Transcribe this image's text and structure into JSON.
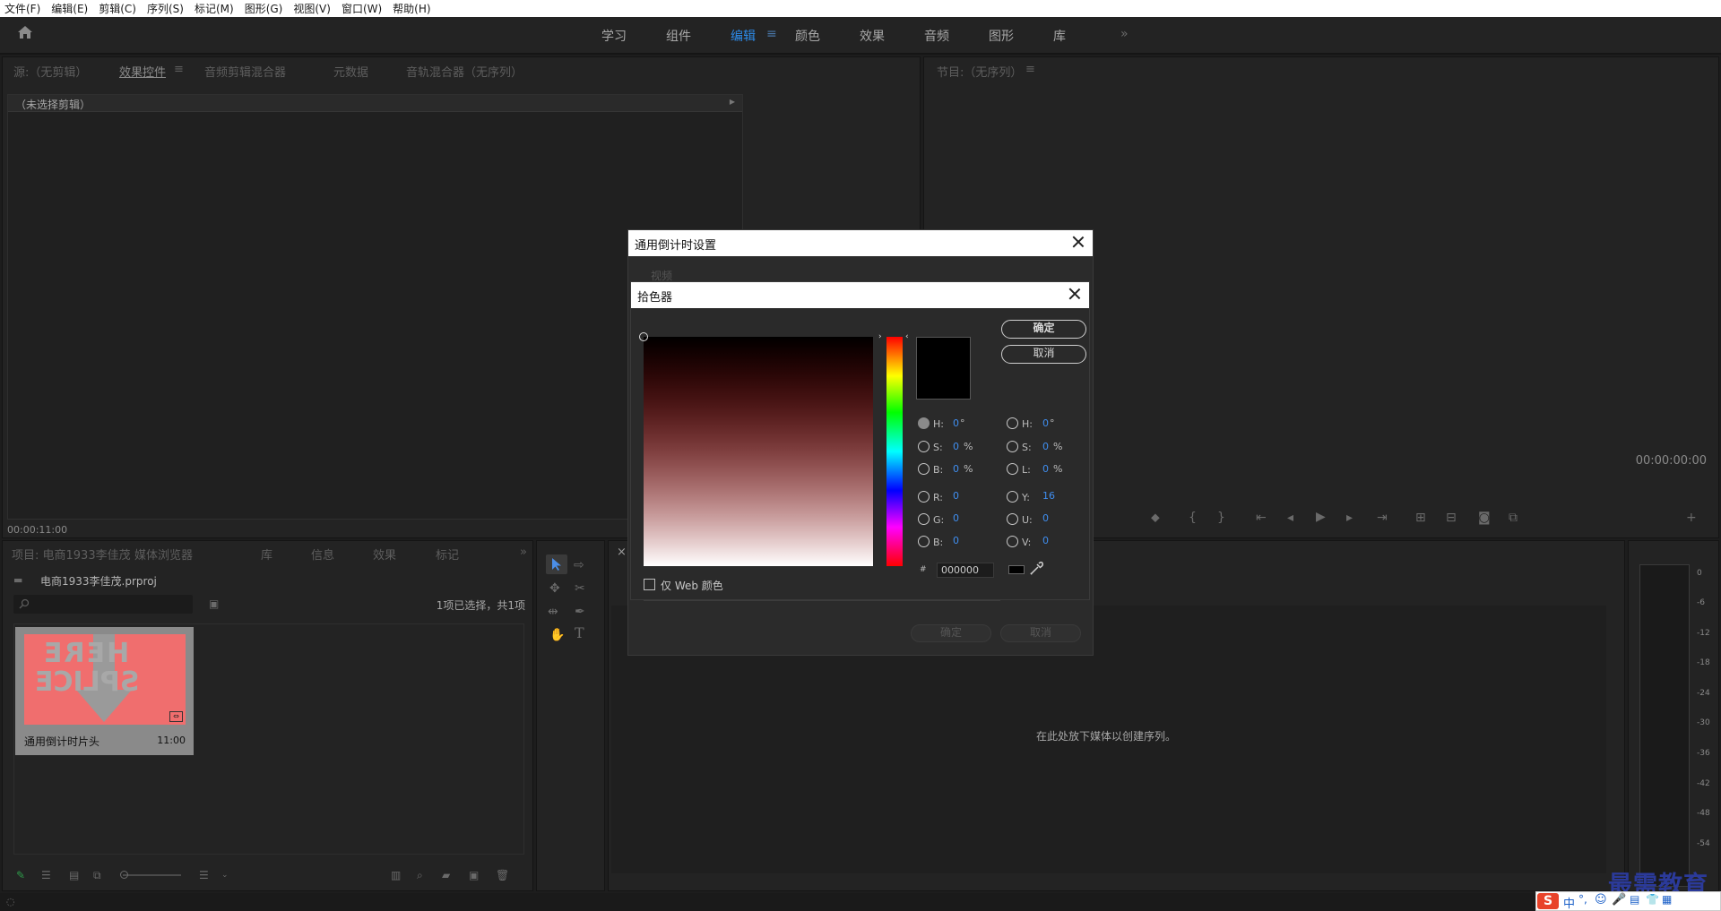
{
  "menu": [
    "文件(F)",
    "编辑(E)",
    "剪辑(C)",
    "序列(S)",
    "标记(M)",
    "图形(G)",
    "视图(V)",
    "窗口(W)",
    "帮助(H)"
  ],
  "workspaces": [
    "学习",
    "组件",
    "编辑",
    "颜色",
    "效果",
    "音频",
    "图形",
    "库"
  ],
  "active_workspace": "编辑",
  "source_panel": {
    "tabs": [
      "源:（无剪辑）",
      "效果控件",
      "音频剪辑混合器",
      "元数据",
      "音轨混合器（无序列）"
    ],
    "header": "（未选择剪辑）",
    "timecode": "00:00:11:00"
  },
  "program_panel": {
    "tab": "节目:（无序列）",
    "timecode": "00:00:00:00"
  },
  "project_panel": {
    "tabs": [
      "项目: 电商1933李佳茂",
      "媒体浏览器",
      "库",
      "信息",
      "效果",
      "标记"
    ],
    "file": "电商1933李佳茂.prproj",
    "selection": "1项已选择，共1项",
    "clip_name": "通用倒计时片头",
    "clip_duration": "11:00",
    "thumb_text": [
      "HERE",
      "SPLICE"
    ]
  },
  "timeline": {
    "empty_text": "在此处放下媒体以创建序列。"
  },
  "meter_labels": [
    "0",
    "-6",
    "-12",
    "-18",
    "-24",
    "-30",
    "-36",
    "-42",
    "-48",
    "-54"
  ],
  "countdown_dialog": {
    "title": "通用倒计时设置",
    "section": "视频",
    "ok": "确定",
    "cancel": "取消"
  },
  "color_picker": {
    "title": "拾色器",
    "ok": "确定",
    "cancel": "取消",
    "web_only": "仅 Web 颜色",
    "hex": "000000",
    "hex_prefix": "#",
    "current_color": "#000000",
    "hue_color": "#ff0000",
    "fields_left": [
      {
        "label": "H:",
        "value": "0",
        "unit": "°"
      },
      {
        "label": "S:",
        "value": "0",
        "unit": "%"
      },
      {
        "label": "B:",
        "value": "0",
        "unit": "%"
      },
      {
        "label": "R:",
        "value": "0",
        "unit": ""
      },
      {
        "label": "G:",
        "value": "0",
        "unit": ""
      },
      {
        "label": "B:",
        "value": "0",
        "unit": ""
      }
    ],
    "fields_right": [
      {
        "label": "H:",
        "value": "0",
        "unit": "°"
      },
      {
        "label": "S:",
        "value": "0",
        "unit": "%"
      },
      {
        "label": "L:",
        "value": "0",
        "unit": "%"
      },
      {
        "label": "Y:",
        "value": "16",
        "unit": ""
      },
      {
        "label": "U:",
        "value": "0",
        "unit": ""
      },
      {
        "label": "V:",
        "value": "0",
        "unit": ""
      }
    ]
  },
  "watermark": "最需教育",
  "ime": {
    "logo": "S",
    "lang": "中"
  }
}
